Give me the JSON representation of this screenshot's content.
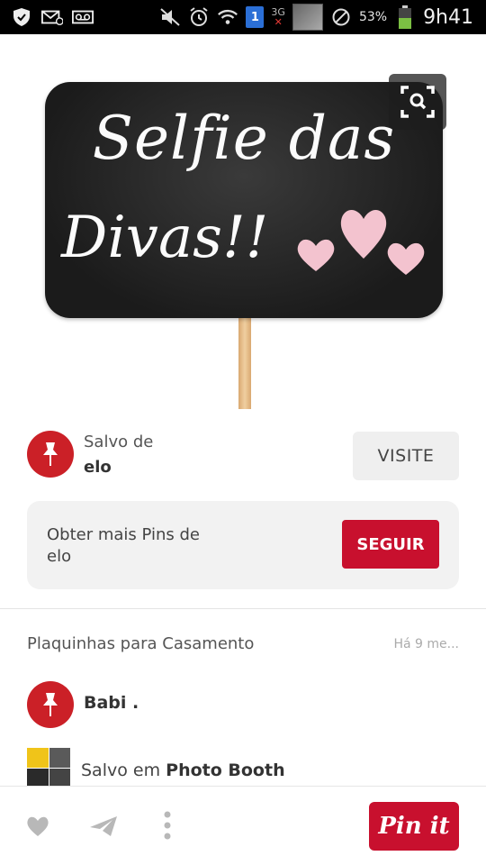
{
  "status_bar": {
    "icons": [
      "shield-icon",
      "mail-icon",
      "voicemail-icon",
      "mute-icon",
      "alarm-icon",
      "wifi-icon",
      "sim-icon",
      "network-3g-icon",
      "signal-icon",
      "no-service-icon",
      "battery-icon"
    ],
    "sim_number": "1",
    "network": "3G",
    "battery": "53%",
    "time": "9h41"
  },
  "pin": {
    "image_text_line1": "Selfie das",
    "image_text_line2": "Divas!!",
    "lens_icon": "visual-search-icon"
  },
  "source": {
    "label": "Salvo de",
    "name": "elo",
    "visit_button": "VISITE"
  },
  "more_pins": {
    "text": "Obter mais Pins de elo",
    "follow_button": "SEGUIR"
  },
  "board": {
    "name": "Plaquinhas para Casamento",
    "time": "Há 9 me..."
  },
  "pinner": {
    "name": "Babi ."
  },
  "saved_in": {
    "prefix": "Salvo em",
    "board": "Photo Booth"
  },
  "footer": {
    "like_icon": "heart-icon",
    "send_icon": "send-icon",
    "more_icon": "more-vertical-icon",
    "pinit_button": "Pin it"
  },
  "colors": {
    "accent": "#c8102e",
    "avatar": "#cb2027",
    "card_bg": "#f2f2f2"
  }
}
